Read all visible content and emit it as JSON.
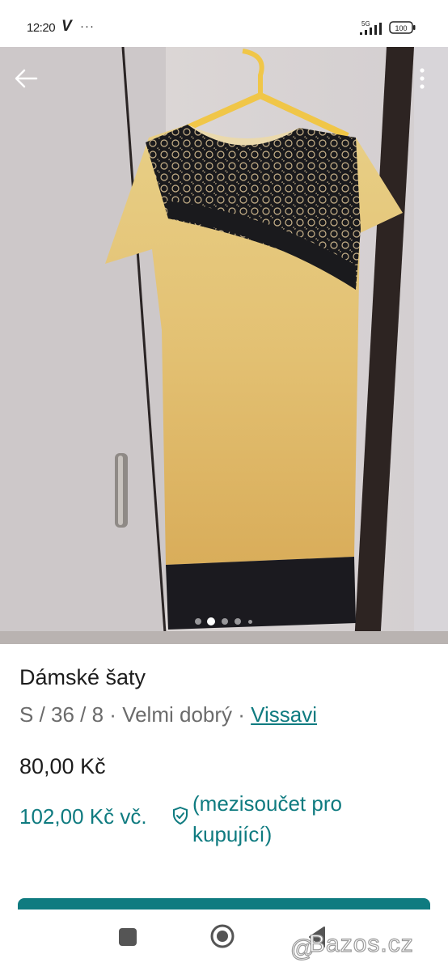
{
  "status_bar": {
    "time": "12:20",
    "carrier_icon": "V",
    "more_indicator": "···",
    "network": "5G",
    "battery": "100"
  },
  "top_actions": {
    "back_icon": "arrow-left-icon",
    "more_icon": "more-vertical-icon"
  },
  "gallery": {
    "image_count": 5,
    "active_index": 1,
    "subject": "yellow dress with black lace on hanger"
  },
  "listing": {
    "title": "Dámské šaty",
    "size": "S / 36 / 8",
    "sep1": " · ",
    "condition": "Velmi dobrý",
    "sep2": " · ",
    "brand": "Vissavi",
    "price": "80,00 Kč",
    "buyer_price": "102,00 Kč  vč.",
    "buyer_note": "(mezisoučet pro kupující)"
  },
  "system_nav": {
    "recents_icon": "square-icon",
    "home_icon": "circle-icon",
    "back_icon": "triangle-back-icon"
  },
  "watermark": {
    "text": "Bazos.cz",
    "at": "@"
  },
  "colors": {
    "accent": "#0f7b80",
    "text": "#1c1c1c",
    "muted": "#6b6b6b"
  }
}
